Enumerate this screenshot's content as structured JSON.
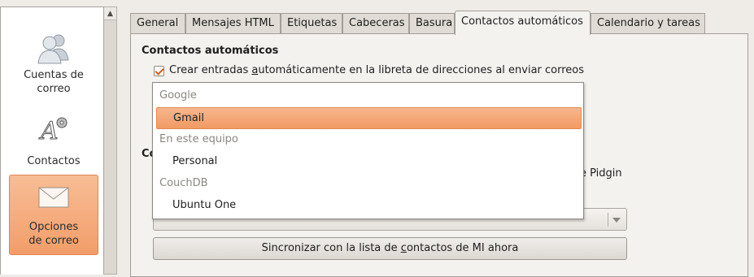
{
  "sidebar": {
    "items": [
      {
        "label_line1": "Cuentas de",
        "label_line2": "correo",
        "icon": "accounts-icon"
      },
      {
        "label_line1": "Contactos",
        "label_line2": "",
        "icon": "contacts-icon"
      },
      {
        "label_line1": "Opciones",
        "label_line2": "de correo",
        "icon": "mail-options-icon"
      }
    ],
    "scroll_up": "▲"
  },
  "tabs": [
    {
      "label": "General"
    },
    {
      "label": "Mensajes HTML"
    },
    {
      "label": "Etiquetas"
    },
    {
      "label": "Cabeceras"
    },
    {
      "label": "Basura"
    },
    {
      "label": "Contactos automáticos",
      "active": true
    },
    {
      "label": "Calendario y tareas"
    }
  ],
  "autocontacts": {
    "section_title": "Contactos automáticos",
    "checkbox_checked": true,
    "checkbox_label_pre": "Crear entradas ",
    "checkbox_label_mnemonic": "a",
    "checkbox_label_post": "utomáticamente en la libreta de direcciones al enviar correos"
  },
  "im_section": {
    "title_partial": "Co",
    "text_tail": "e Pidgin",
    "sync_label_pre": "Sincronizar con la lista de ",
    "sync_label_mnemonic": "c",
    "sync_label_post": "ontactos de MI ahora"
  },
  "dropdown": {
    "groups": [
      {
        "header": "Google",
        "options": [
          {
            "label": "Gmail",
            "selected": true
          }
        ]
      },
      {
        "header": "En este equipo",
        "options": [
          {
            "label": "Personal",
            "selected": false
          }
        ]
      },
      {
        "header": "CouchDB",
        "options": [
          {
            "label": "Ubuntu One",
            "selected": false
          }
        ]
      }
    ]
  },
  "colors": {
    "selection": "#f19a64",
    "check": "#cf5d1d"
  }
}
